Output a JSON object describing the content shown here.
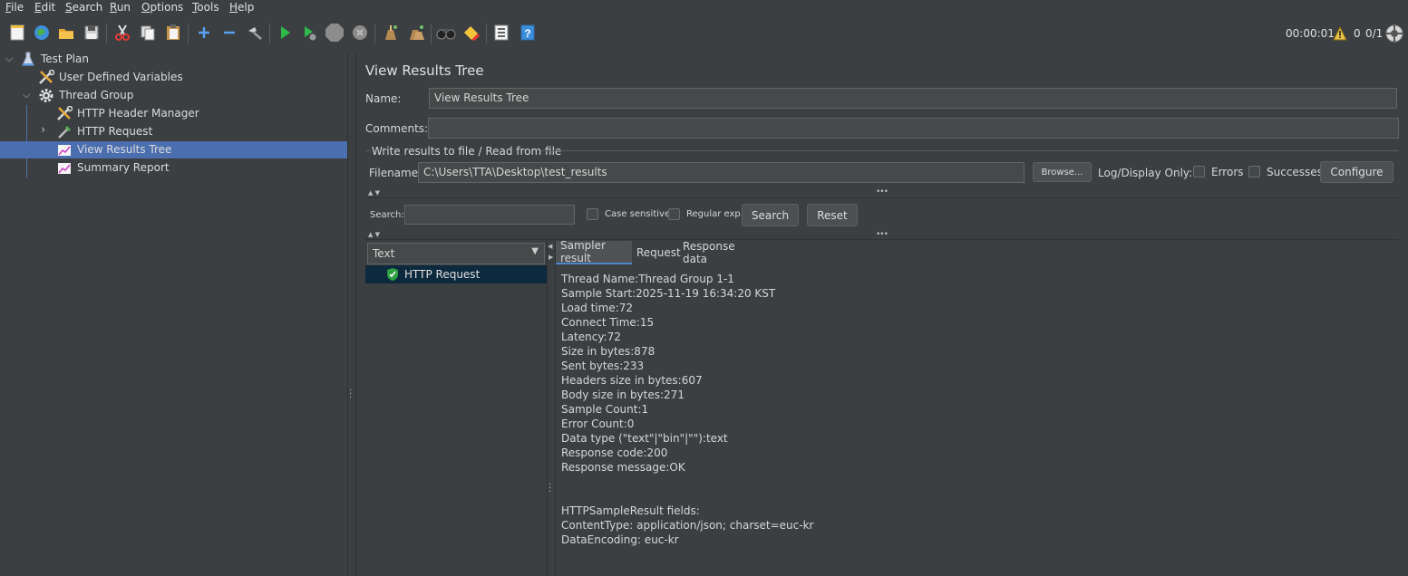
{
  "menu": [
    {
      "underline": "F",
      "rest": "ile"
    },
    {
      "underline": "E",
      "rest": "dit"
    },
    {
      "underline": "S",
      "rest": "earch"
    },
    {
      "underline": "R",
      "rest": "un"
    },
    {
      "underline": "O",
      "rest": "ptions"
    },
    {
      "underline": "T",
      "rest": "ools"
    },
    {
      "underline": "H",
      "rest": "elp"
    }
  ],
  "toolbar_icons": [
    "new-icon",
    "templates-icon",
    "open-icon",
    "save-icon",
    "cut-icon",
    "copy-icon",
    "paste-icon",
    "expand-icon",
    "collapse-icon",
    "toggle-icon",
    "start-icon",
    "start-no-pauses-icon",
    "stop-icon",
    "shutdown-icon",
    "clear-icon",
    "clear-all-icon",
    "search-icon",
    "reset-search-icon",
    "function-helper-icon",
    "help-icon"
  ],
  "status": {
    "time": "00:00:01",
    "warnings": "0",
    "threads": "0/1"
  },
  "tree": [
    {
      "label": "Test Plan",
      "icon": "flask-icon"
    },
    {
      "label": "User Defined Variables",
      "icon": "wrench-icon"
    },
    {
      "label": "Thread Group",
      "icon": "gear-icon"
    },
    {
      "label": "HTTP Header Manager",
      "icon": "wrench-icon"
    },
    {
      "label": "HTTP Request",
      "icon": "pipette-icon"
    },
    {
      "label": "View Results Tree",
      "icon": "graph-icon"
    },
    {
      "label": "Summary Report",
      "icon": "graph-icon"
    }
  ],
  "panel": {
    "title": "View Results Tree",
    "name_label": "Name:",
    "name_value": "View Results Tree",
    "comments_label": "Comments:",
    "comments_value": "",
    "file_section_title": "Write results to file / Read from file",
    "filename_label": "Filename",
    "filename_value": "C:\\Users\\TTA\\Desktop\\test_results",
    "browse_label": "Browse...",
    "log_display_label": "Log/Display Only:",
    "errors_label": "Errors",
    "successes_label": "Successes",
    "configure_label": "Configure",
    "search_label": "Search:",
    "search_value": "",
    "case_sensitive_label": "Case sensitive",
    "regular_exp_label": "Regular exp.",
    "search_button": "Search",
    "reset_button": "Reset"
  },
  "renderer": {
    "selected": "Text"
  },
  "results": [
    {
      "label": "HTTP Request",
      "status": "success"
    }
  ],
  "tabs": [
    "Sampler result",
    "Request",
    "Response data"
  ],
  "detail_lines": [
    "Thread Name:Thread Group 1-1",
    "Sample Start:2025-11-19 16:34:20 KST",
    "Load time:72",
    "Connect Time:15",
    "Latency:72",
    "Size in bytes:878",
    "Sent bytes:233",
    "Headers size in bytes:607",
    "Body size in bytes:271",
    "Sample Count:1",
    "Error Count:0",
    "Data type (\"text\"|\"bin\"|\"\"):text",
    "Response code:200",
    "Response message:OK",
    "",
    "",
    "HTTPSampleResult fields:",
    "ContentType: application/json; charset=euc-kr",
    "DataEncoding: euc-kr"
  ],
  "colors": {
    "background": "#3c3f41",
    "selection": "#4b6eaf",
    "result_selection": "#0d293e",
    "success": "#2ea043",
    "warning": "#e8c24a"
  }
}
